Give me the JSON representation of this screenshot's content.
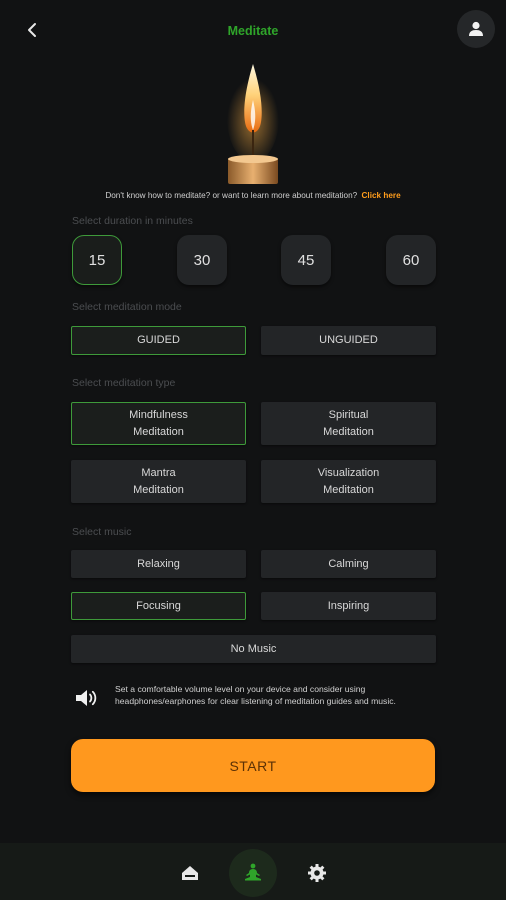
{
  "header": {
    "title": "Meditate",
    "back_icon": "chevron-left-icon",
    "profile_icon": "user-icon"
  },
  "learn_more": {
    "text": "Don't know how to meditate? or want to learn more about meditation?",
    "link": "Click here"
  },
  "duration": {
    "label": "Select duration in minutes",
    "options": [
      "15",
      "30",
      "45",
      "60"
    ],
    "selected": "15"
  },
  "mode": {
    "label": "Select meditation mode",
    "options": [
      "GUIDED",
      "UNGUIDED"
    ],
    "selected": "GUIDED"
  },
  "type": {
    "label": "Select meditation type",
    "options": [
      {
        "line1": "Mindfulness",
        "line2": "Meditation"
      },
      {
        "line1": "Spiritual",
        "line2": "Meditation"
      },
      {
        "line1": "Mantra",
        "line2": "Meditation"
      },
      {
        "line1": "Visualization",
        "line2": "Meditation"
      }
    ],
    "selected": "Mindfulness Meditation"
  },
  "music": {
    "label": "Select music",
    "options": [
      "Relaxing",
      "Calming",
      "Focusing",
      "Inspiring",
      "No Music"
    ],
    "selected": "Focusing"
  },
  "volume_note": {
    "icon": "speaker-icon",
    "text": "Set a comfortable volume level on your device and consider using headphones/earphones for clear listening of meditation guides and music."
  },
  "start_button": "START",
  "nav": {
    "items": [
      "home-icon",
      "meditate-icon",
      "settings-icon"
    ],
    "active": "meditate-icon"
  },
  "colors": {
    "accent_green": "#3e9a3a",
    "title_green": "#2fa52a",
    "start_orange": "#ff981e",
    "link_orange": "#ff9d1c",
    "background": "#111213"
  }
}
